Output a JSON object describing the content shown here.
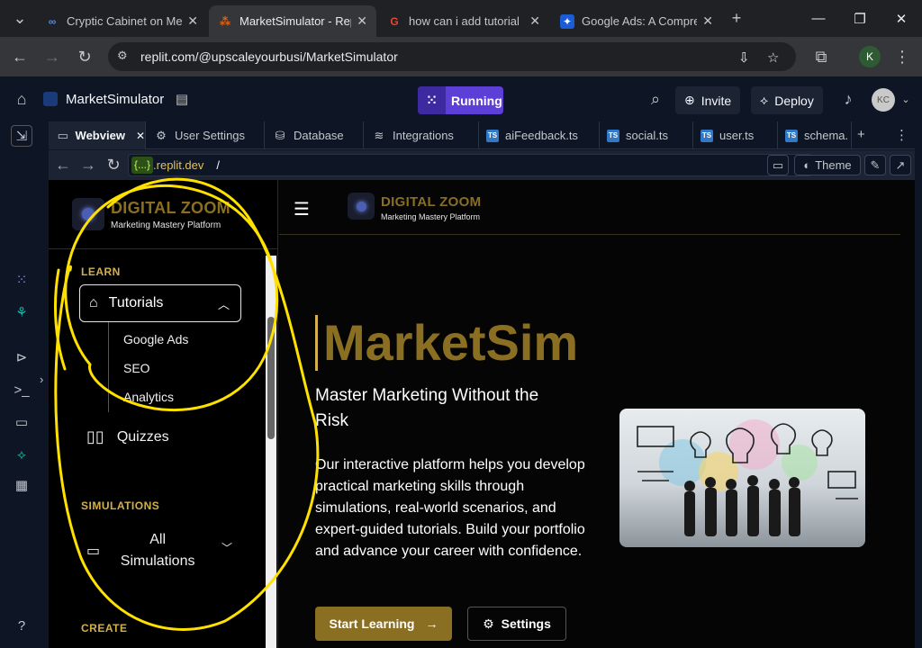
{
  "browser": {
    "tabs": [
      {
        "title": "Cryptic Cabinet on Met",
        "icon": "meta-icon"
      },
      {
        "title": "MarketSimulator - Rep",
        "icon": "replit-icon"
      },
      {
        "title": "how can i add tutorial",
        "icon": "google-icon"
      },
      {
        "title": "Google Ads: A Compre",
        "icon": "butterfly-icon"
      }
    ],
    "url": "replit.com/@upscaleyourbusi/MarketSimulator"
  },
  "replit": {
    "project_name": "MarketSimulator",
    "run_status": "Running",
    "invite_label": "Invite",
    "deploy_label": "Deploy",
    "avatar_initials": "KC",
    "tabs": [
      {
        "label": "Webview"
      },
      {
        "label": "User Settings"
      },
      {
        "label": "Database"
      },
      {
        "label": "Integrations"
      },
      {
        "label": "aiFeedback.ts"
      },
      {
        "label": "social.ts"
      },
      {
        "label": "user.ts"
      },
      {
        "label": "schema."
      }
    ],
    "webview": {
      "host_badge": "{...}",
      "host": ".replit.dev",
      "path": "/",
      "theme_label": "Theme"
    },
    "help_label": "?"
  },
  "app": {
    "brand_title": "DIGITAL ZOOM",
    "brand_subtitle": "Marketing Mastery Platform",
    "sidebar": {
      "learn_label": "LEARN",
      "tutorials_label": "Tutorials",
      "sub_items": [
        "Google Ads",
        "SEO",
        "Analytics"
      ],
      "quizzes_label": "Quizzes",
      "simulations_label": "SIMULATIONS",
      "all_sims_line1": "All",
      "all_sims_line2": "Simulations",
      "create_label": "CREATE"
    },
    "hero": {
      "title": "MarketSim",
      "subtitle": "Master Marketing Without the Risk",
      "body": "Our interactive platform helps you develop practical marketing skills through simulations, real-world scenarios, and expert-guided tutorials. Build your portfolio and advance your career with confidence.",
      "start_label": "Start Learning",
      "settings_label": "Settings"
    }
  },
  "colors": {
    "gold": "#8a6f22",
    "gold_light": "#d4b04a",
    "running_purple": "#5c3fd6",
    "annotation_yellow": "#ffe100"
  }
}
